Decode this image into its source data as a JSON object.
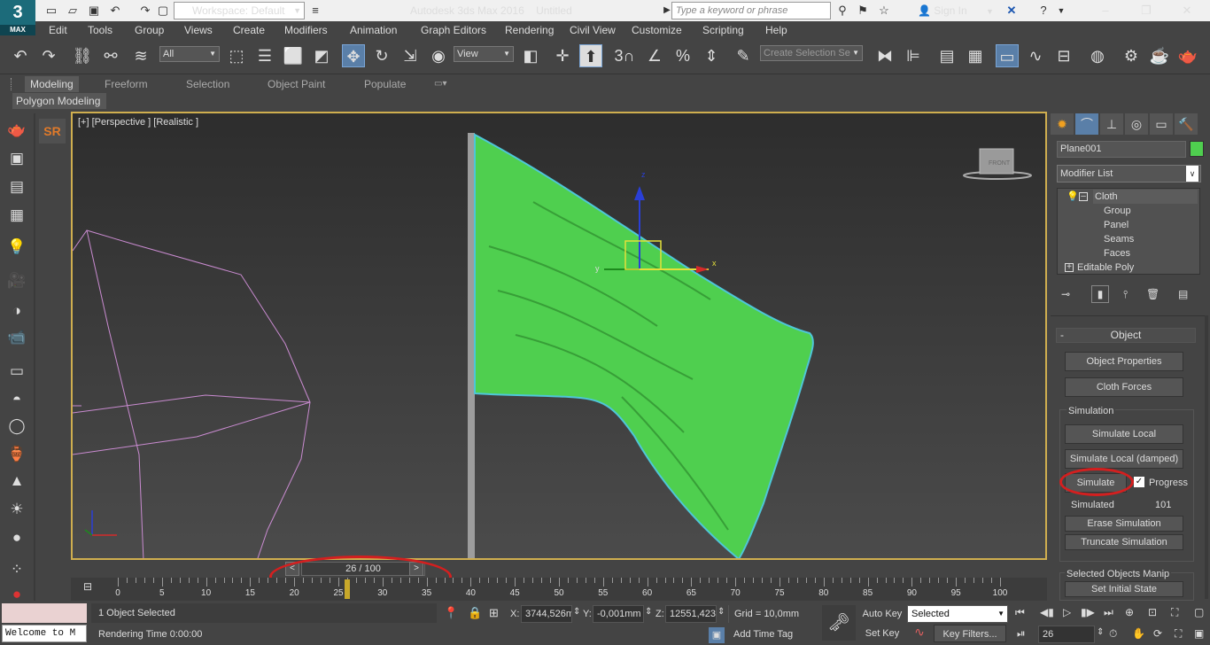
{
  "window": {
    "app_title": "Autodesk 3ds Max 2016",
    "doc_title": "Untitled",
    "logo_text": "MAX",
    "workspace": "Workspace: Default",
    "search_placeholder": "Type a keyword or phrase",
    "sign_in": "Sign In"
  },
  "menu": [
    "Edit",
    "Tools",
    "Group",
    "Views",
    "Create",
    "Modifiers",
    "Animation",
    "Graph Editors",
    "Rendering",
    "Civil View",
    "Customize",
    "Scripting",
    "Help"
  ],
  "toolbar": {
    "selection_filter": "All",
    "ref_coord": "View",
    "selection_set_placeholder": "Create Selection Se",
    "snap_3": "3"
  },
  "ribbon": {
    "tabs": [
      "Modeling",
      "Freeform",
      "Selection",
      "Object Paint",
      "Populate"
    ],
    "active_tab": "Modeling",
    "panel_label": "Polygon Modeling"
  },
  "viewport": {
    "label": "[+] [Perspective ] [Realistic ]",
    "viewcube_label": "FRONT",
    "gizmo_x": "x",
    "gizmo_y": "y",
    "gizmo_z": "z"
  },
  "timeline": {
    "frame_display": "26 / 100",
    "current_frame": 26,
    "total_frames": 100,
    "tick_labels": [
      "0",
      "5",
      "10",
      "15",
      "20",
      "25",
      "30",
      "35",
      "40",
      "45",
      "50",
      "55",
      "60",
      "65",
      "70",
      "75",
      "80",
      "85",
      "90",
      "95",
      "100"
    ]
  },
  "status": {
    "listener": "Welcome to M",
    "selection": "1 Object Selected",
    "render_time": "Rendering Time  0:00:00",
    "x_label": "X:",
    "x_value": "3744,526mm",
    "y_label": "Y:",
    "y_value": "-0,001mm",
    "z_label": "Z:",
    "z_value": "12551,423",
    "grid": "Grid = 10,0mm",
    "add_time_tag": "Add Time Tag",
    "auto_key": "Auto Key",
    "set_key": "Set Key",
    "key_mode": "Selected",
    "key_filters": "Key Filters...",
    "frame_field": "26"
  },
  "command_panel": {
    "object_name": "Plane001",
    "object_color": "#4fcf4f",
    "modifier_list": "Modifier List",
    "stack": {
      "cloth": "Cloth",
      "sub": [
        "Group",
        "Panel",
        "Seams",
        "Faces"
      ],
      "editable_poly": "Editable Poly"
    },
    "rollout_object": "Object",
    "btn_object_properties": "Object Properties",
    "btn_cloth_forces": "Cloth Forces",
    "group_simulation": "Simulation",
    "btn_simulate_local": "Simulate Local",
    "btn_simulate_local_damped": "Simulate Local (damped)",
    "btn_simulate": "Simulate",
    "chk_progress": "Progress",
    "simulated_label": "Simulated",
    "simulated_value": "101",
    "btn_erase_simulation": "Erase Simulation",
    "btn_truncate_simulation": "Truncate Simulation",
    "group_selected_objects_manip": "Selected Objects Manip",
    "btn_set_initial_state": "Set Initial State"
  },
  "colors": {
    "accent": "#5a7fa8",
    "viewport_border": "#cfae4f",
    "cloth_green": "#4fcf4f",
    "annotation_red": "#d41f1f",
    "sr_orange": "#e07a2a"
  }
}
